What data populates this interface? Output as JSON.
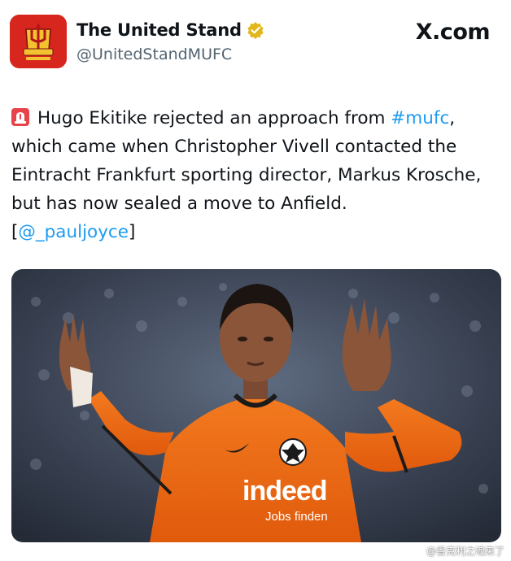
{
  "account": {
    "display_name": "The United Stand",
    "handle": "@UnitedStandMUFC",
    "verified_icon": "verified-badge-icon",
    "avatar_icon": "trident-crest-icon"
  },
  "platform": {
    "label": "X.com"
  },
  "tweet": {
    "emoji_icon": "siren-icon",
    "line1_part1": "Hugo Ekitike rejected an approach from ",
    "hashtag": "#mufc",
    "line1_part2": ", which came when Christopher Vivell contacted the Eintracht Frankfurt sporting director, Markus Krosche, but has now sealed a move to Anfield.",
    "bracket_open": "[",
    "mention": "@_pauljoyce",
    "bracket_close": "]"
  },
  "photo": {
    "sponsor_main": "indeed",
    "sponsor_sub": "Jobs finden"
  },
  "watermark": {
    "text": "@香克利之魂来了"
  },
  "colors": {
    "link": "#1d9bf0",
    "kit_orange": "#f06a12",
    "avatar_red": "#d7261e"
  }
}
